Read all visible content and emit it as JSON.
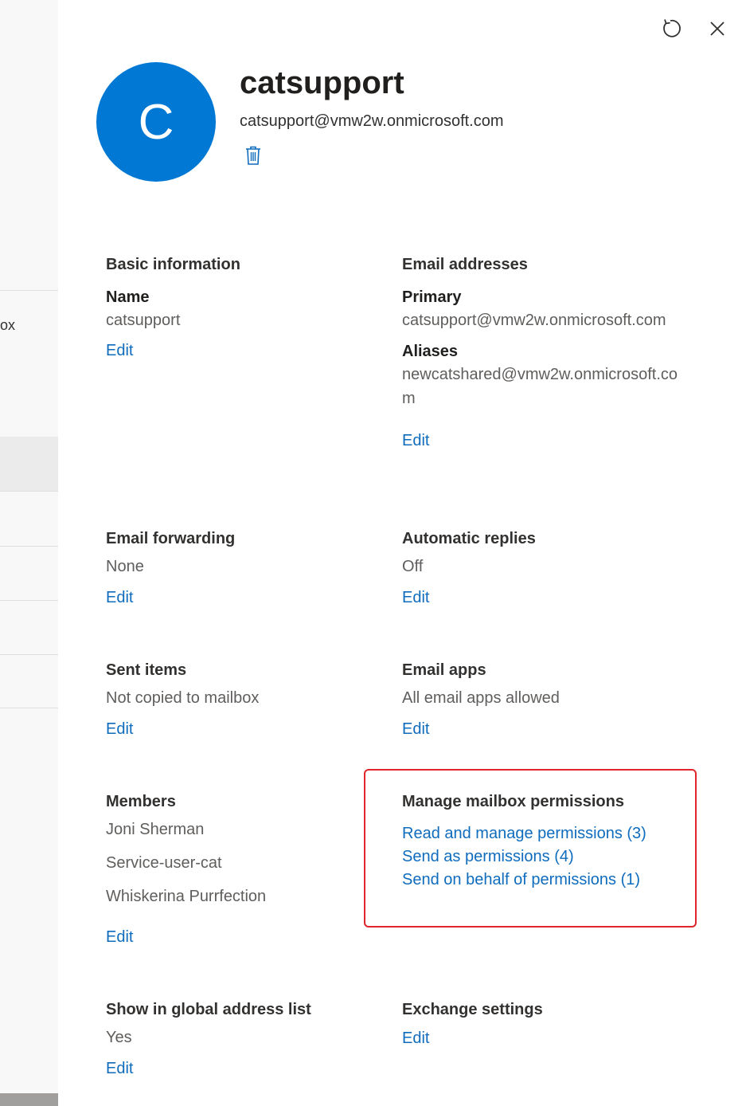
{
  "background": {
    "fragment_text": "ox"
  },
  "header": {
    "avatar_letter": "C",
    "title": "catsupport",
    "email": "catsupport@vmw2w.onmicrosoft.com"
  },
  "basic_information": {
    "heading": "Basic information",
    "name_label": "Name",
    "name_value": "catsupport",
    "edit": "Edit"
  },
  "email_addresses": {
    "heading": "Email addresses",
    "primary_label": "Primary",
    "primary_value": "catsupport@vmw2w.onmicrosoft.com",
    "aliases_label": "Aliases",
    "aliases_value": "newcatshared@vmw2w.onmicrosoft.com",
    "edit": "Edit"
  },
  "email_forwarding": {
    "heading": "Email forwarding",
    "value": "None",
    "edit": "Edit"
  },
  "automatic_replies": {
    "heading": "Automatic replies",
    "value": "Off",
    "edit": "Edit"
  },
  "sent_items": {
    "heading": "Sent items",
    "value": "Not copied to mailbox",
    "edit": "Edit"
  },
  "email_apps": {
    "heading": "Email apps",
    "value": "All email apps allowed",
    "edit": "Edit"
  },
  "members": {
    "heading": "Members",
    "items": [
      "Joni Sherman",
      "Service-user-cat",
      "Whiskerina Purrfection"
    ],
    "edit": "Edit"
  },
  "manage_permissions": {
    "heading": "Manage mailbox permissions",
    "read_manage": "Read and manage permissions (3)",
    "send_as": "Send as permissions (4)",
    "send_on_behalf": "Send on behalf of permissions (1)",
    "highlight_color": "#e0262b"
  },
  "global_address_list": {
    "heading": "Show in global address list",
    "value": "Yes",
    "edit": "Edit"
  },
  "exchange_settings": {
    "heading": "Exchange settings",
    "edit": "Edit"
  },
  "colors": {
    "accent": "#0078d4",
    "link": "#0f6cbd"
  }
}
